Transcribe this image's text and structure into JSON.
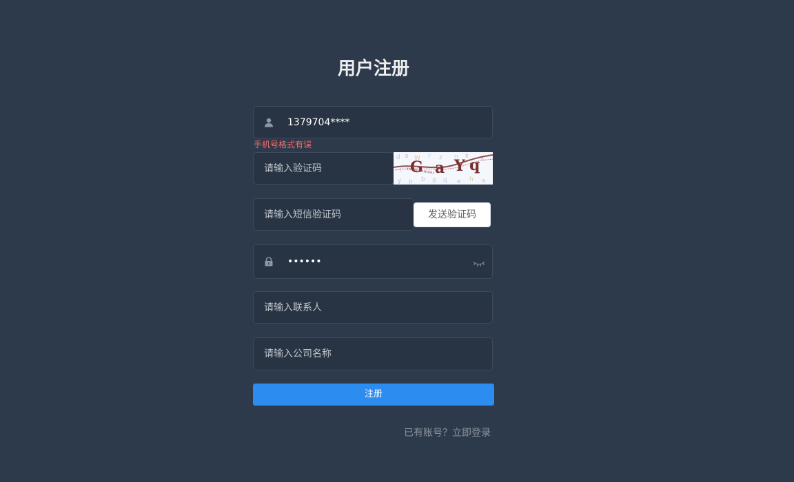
{
  "form": {
    "title": "用户注册",
    "phone": {
      "value": "1379704****",
      "error": "手机号格式有误"
    },
    "captcha": {
      "placeholder": "请输入验证码"
    },
    "sms": {
      "placeholder": "请输入短信验证码",
      "button_label": "发送验证码"
    },
    "password": {
      "value": "••••••"
    },
    "contact": {
      "placeholder": "请输入联系人"
    },
    "company": {
      "placeholder": "请输入公司名称"
    },
    "submit_label": "注册",
    "login_link": "已有账号？立即登录"
  },
  "icons": {
    "phone": "user-icon",
    "password": "lock-icon",
    "toggle": "eye-closed-icon"
  },
  "colors": {
    "background": "#2d3a4b",
    "input_bg": "#283443",
    "primary": "#2d8cf0",
    "error": "#f56c6c",
    "link": "#8c939d"
  }
}
